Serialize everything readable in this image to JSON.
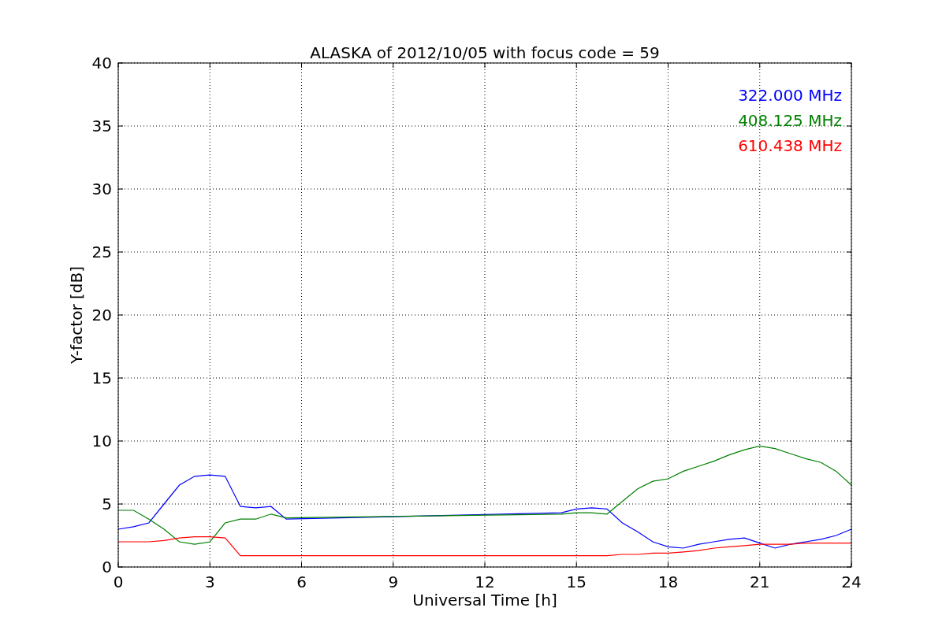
{
  "chart_data": {
    "type": "line",
    "title": "ALASKA of 2012/10/05 with focus code = 59",
    "xlabel": "Universal Time [h]",
    "ylabel": "Y-factor [dB]",
    "x": [
      0,
      0.5,
      1,
      1.5,
      2,
      2.5,
      3,
      3.5,
      4,
      4.5,
      5,
      5.5,
      14.5,
      15,
      15.5,
      16,
      16.5,
      17,
      17.5,
      18,
      18.5,
      19,
      19.5,
      20,
      20.5,
      21,
      21.5,
      22,
      22.5,
      23,
      23.5,
      24
    ],
    "series": [
      {
        "name": "322.000 MHz",
        "color": "#0000ff",
        "values": [
          3,
          3.2,
          3.5,
          5,
          6.5,
          7.2,
          7.3,
          7.2,
          4.8,
          4.7,
          4.8,
          3.8,
          4.3,
          4.6,
          4.7,
          4.6,
          3.5,
          2.8,
          2,
          1.6,
          1.5,
          1.8,
          2,
          2.2,
          2.3,
          1.9,
          1.5,
          1.8,
          2,
          2.2,
          2.5,
          3
        ]
      },
      {
        "name": "408.125 MHz",
        "color": "#008000",
        "values": [
          4.5,
          4.5,
          3.8,
          3,
          2,
          1.8,
          2,
          3.5,
          3.8,
          3.8,
          4.2,
          3.9,
          4.2,
          4.3,
          4.3,
          4.2,
          5.2,
          6.2,
          6.8,
          7,
          7.6,
          8,
          8.4,
          8.9,
          9.3,
          9.6,
          9.4,
          9,
          8.6,
          8.3,
          7.6,
          6.5
        ]
      },
      {
        "name": "610.438 MHz",
        "color": "#ff0000",
        "values": [
          2,
          2,
          2,
          2.1,
          2.3,
          2.4,
          2.4,
          2.3,
          0.9,
          0.9,
          0.9,
          0.9,
          0.9,
          0.9,
          0.9,
          0.9,
          1,
          1,
          1.1,
          1.1,
          1.2,
          1.3,
          1.5,
          1.6,
          1.7,
          1.8,
          1.8,
          1.8,
          1.9,
          1.9,
          1.9,
          1.9
        ]
      }
    ],
    "grid": true,
    "xlim": [
      0,
      24
    ],
    "ylim": [
      0,
      40
    ],
    "xticks": [
      0,
      3,
      6,
      9,
      12,
      15,
      18,
      21,
      24
    ],
    "yticks": [
      0,
      5,
      10,
      15,
      20,
      25,
      30,
      35,
      40
    ]
  }
}
